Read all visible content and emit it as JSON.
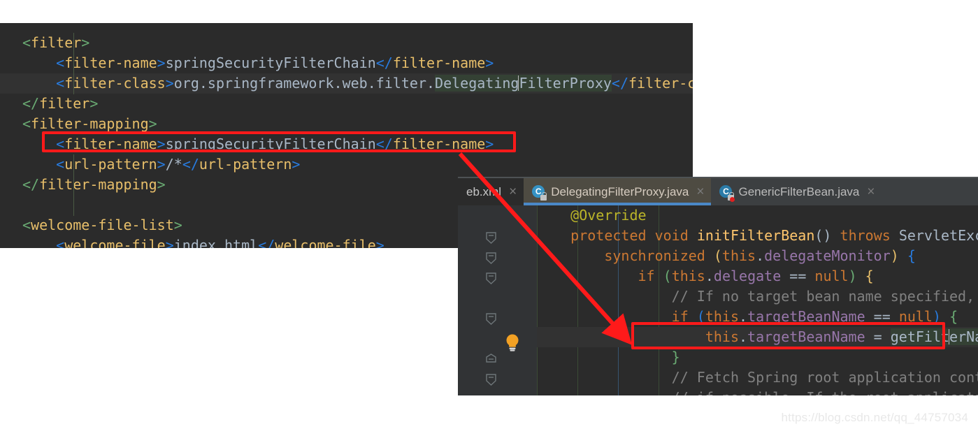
{
  "xml_editor": {
    "name": "web.xml editor",
    "lines": [
      {
        "indent": 0,
        "parts": [
          {
            "t": "brk",
            "s": "<"
          },
          {
            "t": "tag",
            "s": "filter"
          },
          {
            "t": "brk",
            "s": ">"
          }
        ]
      },
      {
        "indent": 1,
        "parts": [
          {
            "t": "brk2",
            "s": "<"
          },
          {
            "t": "tag",
            "s": "filter-name"
          },
          {
            "t": "brk2",
            "s": ">"
          },
          {
            "t": "txt",
            "s": "springSecurityFilterChain"
          },
          {
            "t": "brk2",
            "s": "</"
          },
          {
            "t": "tag",
            "s": "filter-name"
          },
          {
            "t": "brk2",
            "s": ">"
          }
        ]
      },
      {
        "indent": 1,
        "highlight": true,
        "parts": [
          {
            "t": "brk2",
            "s": "<"
          },
          {
            "t": "tag",
            "s": "filter-class"
          },
          {
            "t": "brk2",
            "s": ">"
          },
          {
            "t": "txt",
            "s": "org.springframework.web.filter."
          },
          {
            "t": "sel",
            "s": "Delegating"
          },
          {
            "t": "caret",
            "s": ""
          },
          {
            "t": "sel",
            "s": "FilterProxy"
          },
          {
            "t": "brk2",
            "s": "</"
          },
          {
            "t": "tag",
            "s": "filter-class"
          },
          {
            "t": "brk2",
            "s": ">"
          }
        ]
      },
      {
        "indent": 0,
        "parts": [
          {
            "t": "brk",
            "s": "</"
          },
          {
            "t": "tag",
            "s": "filter"
          },
          {
            "t": "brk",
            "s": ">"
          }
        ]
      },
      {
        "indent": 0,
        "parts": [
          {
            "t": "brk",
            "s": "<"
          },
          {
            "t": "tag",
            "s": "filter-mapping"
          },
          {
            "t": "brk",
            "s": ">"
          }
        ]
      },
      {
        "indent": 1,
        "parts": [
          {
            "t": "brk2",
            "s": "<"
          },
          {
            "t": "tag",
            "s": "filter-name"
          },
          {
            "t": "brk2",
            "s": ">"
          },
          {
            "t": "txt",
            "s": "springSecurityFilterChain"
          },
          {
            "t": "brk2",
            "s": "</"
          },
          {
            "t": "tag",
            "s": "filter-name"
          },
          {
            "t": "brk2",
            "s": ">"
          }
        ]
      },
      {
        "indent": 1,
        "parts": [
          {
            "t": "brk2",
            "s": "<"
          },
          {
            "t": "tag",
            "s": "url-pattern"
          },
          {
            "t": "brk2",
            "s": ">"
          },
          {
            "t": "txt",
            "s": "/*"
          },
          {
            "t": "brk2",
            "s": "</"
          },
          {
            "t": "tag",
            "s": "url-pattern"
          },
          {
            "t": "brk2",
            "s": ">"
          }
        ]
      },
      {
        "indent": 0,
        "parts": [
          {
            "t": "brk",
            "s": "</"
          },
          {
            "t": "tag",
            "s": "filter-mapping"
          },
          {
            "t": "brk",
            "s": ">"
          }
        ]
      },
      {
        "indent": 0,
        "parts": []
      },
      {
        "indent": 0,
        "parts": [
          {
            "t": "brk",
            "s": "<"
          },
          {
            "t": "tag",
            "s": "welcome-file-list"
          },
          {
            "t": "brk",
            "s": ">"
          }
        ]
      },
      {
        "indent": 1,
        "parts": [
          {
            "t": "brk2",
            "s": "<"
          },
          {
            "t": "tag",
            "s": "welcome-file"
          },
          {
            "t": "brk2",
            "s": ">"
          },
          {
            "t": "txt",
            "s": "index.html"
          },
          {
            "t": "brk2",
            "s": "</"
          },
          {
            "t": "tag",
            "s": "welcome-file"
          },
          {
            "t": "brk2",
            "s": ">"
          }
        ]
      }
    ]
  },
  "java_editor": {
    "tabs": [
      {
        "label": "eb.xml",
        "icon": "",
        "state": "inactive-dim",
        "close": "×"
      },
      {
        "label": "DelegatingFilterProxy.java",
        "icon": "java-class-icon",
        "state": "active",
        "close": "×"
      },
      {
        "label": "GenericFilterBean.java",
        "icon": "java-class-icon",
        "state": "inactive",
        "close": "×"
      }
    ],
    "lines": [
      {
        "indent": 1,
        "parts": [
          {
            "t": "ann",
            "s": "@Override"
          }
        ]
      },
      {
        "indent": 1,
        "parts": [
          {
            "t": "kw",
            "s": "protected"
          },
          {
            "t": "cls",
            "s": " "
          },
          {
            "t": "kw",
            "s": "void"
          },
          {
            "t": "cls",
            "s": " "
          },
          {
            "t": "meth",
            "s": "initFilterBean"
          },
          {
            "t": "par",
            "s": "()"
          },
          {
            "t": "cls",
            "s": " "
          },
          {
            "t": "kw",
            "s": "throws"
          },
          {
            "t": "cls",
            "s": " ServletException "
          },
          {
            "t": "pg",
            "s": "{"
          }
        ]
      },
      {
        "indent": 2,
        "parts": [
          {
            "t": "kw",
            "s": "synchronized"
          },
          {
            "t": "cls",
            "s": " "
          },
          {
            "t": "py",
            "s": "("
          },
          {
            "t": "kw",
            "s": "this"
          },
          {
            "t": "cls",
            "s": "."
          },
          {
            "t": "fld",
            "s": "delegateMonitor"
          },
          {
            "t": "py",
            "s": ")"
          },
          {
            "t": "cls",
            "s": " "
          },
          {
            "t": "pb",
            "s": "{"
          }
        ]
      },
      {
        "indent": 3,
        "parts": [
          {
            "t": "kw",
            "s": "if"
          },
          {
            "t": "cls",
            "s": " "
          },
          {
            "t": "pg",
            "s": "("
          },
          {
            "t": "kw",
            "s": "this"
          },
          {
            "t": "cls",
            "s": "."
          },
          {
            "t": "fld",
            "s": "delegate"
          },
          {
            "t": "cls",
            "s": " == "
          },
          {
            "t": "kw",
            "s": "null"
          },
          {
            "t": "pg",
            "s": ")"
          },
          {
            "t": "cls",
            "s": " "
          },
          {
            "t": "py",
            "s": "{"
          }
        ]
      },
      {
        "indent": 4,
        "parts": [
          {
            "t": "cmt",
            "s": "// If no target bean name specified, use filter"
          }
        ]
      },
      {
        "indent": 4,
        "parts": [
          {
            "t": "kw",
            "s": "if"
          },
          {
            "t": "cls",
            "s": " "
          },
          {
            "t": "pb",
            "s": "("
          },
          {
            "t": "kw",
            "s": "this"
          },
          {
            "t": "cls",
            "s": "."
          },
          {
            "t": "fld",
            "s": "targetBeanName"
          },
          {
            "t": "cls",
            "s": " == "
          },
          {
            "t": "kw",
            "s": "null"
          },
          {
            "t": "pb",
            "s": ")"
          },
          {
            "t": "cls",
            "s": " "
          },
          {
            "t": "pg",
            "s": "{"
          }
        ]
      },
      {
        "indent": 5,
        "highlight": true,
        "parts": [
          {
            "t": "kw",
            "s": "this"
          },
          {
            "t": "cls",
            "s": "."
          },
          {
            "t": "fld",
            "s": "targetBeanName"
          },
          {
            "t": "cls",
            "s": " = "
          },
          {
            "t": "jsel",
            "s": "getFilt"
          },
          {
            "t": "caret",
            "s": ""
          },
          {
            "t": "jsel",
            "s": "erName"
          },
          {
            "t": "pv",
            "s": "()"
          },
          {
            "t": "cls",
            "s": ";"
          }
        ]
      },
      {
        "indent": 4,
        "parts": [
          {
            "t": "pg",
            "s": "}"
          }
        ]
      },
      {
        "indent": 4,
        "parts": [
          {
            "t": "cmt",
            "s": "// Fetch Spring root application context and ini"
          }
        ]
      },
      {
        "indent": 4,
        "parts": [
          {
            "t": "cmt",
            "s": "// if possible. If the root application context"
          }
        ]
      }
    ],
    "gutter": {
      "folds": [
        "minus",
        "minus",
        "minus",
        "minus",
        "collapsed",
        "minus"
      ],
      "bulb": "intention-bulb-icon"
    }
  },
  "annotations": {
    "box1_label": "highlight-filter-name-line",
    "box2_label": "highlight-target-bean-name-line",
    "arrow_label": "red-arrow-connector",
    "color": "#ff1a1a"
  },
  "watermark": {
    "text": "https://blog.csdn.net/qq_44757034"
  }
}
